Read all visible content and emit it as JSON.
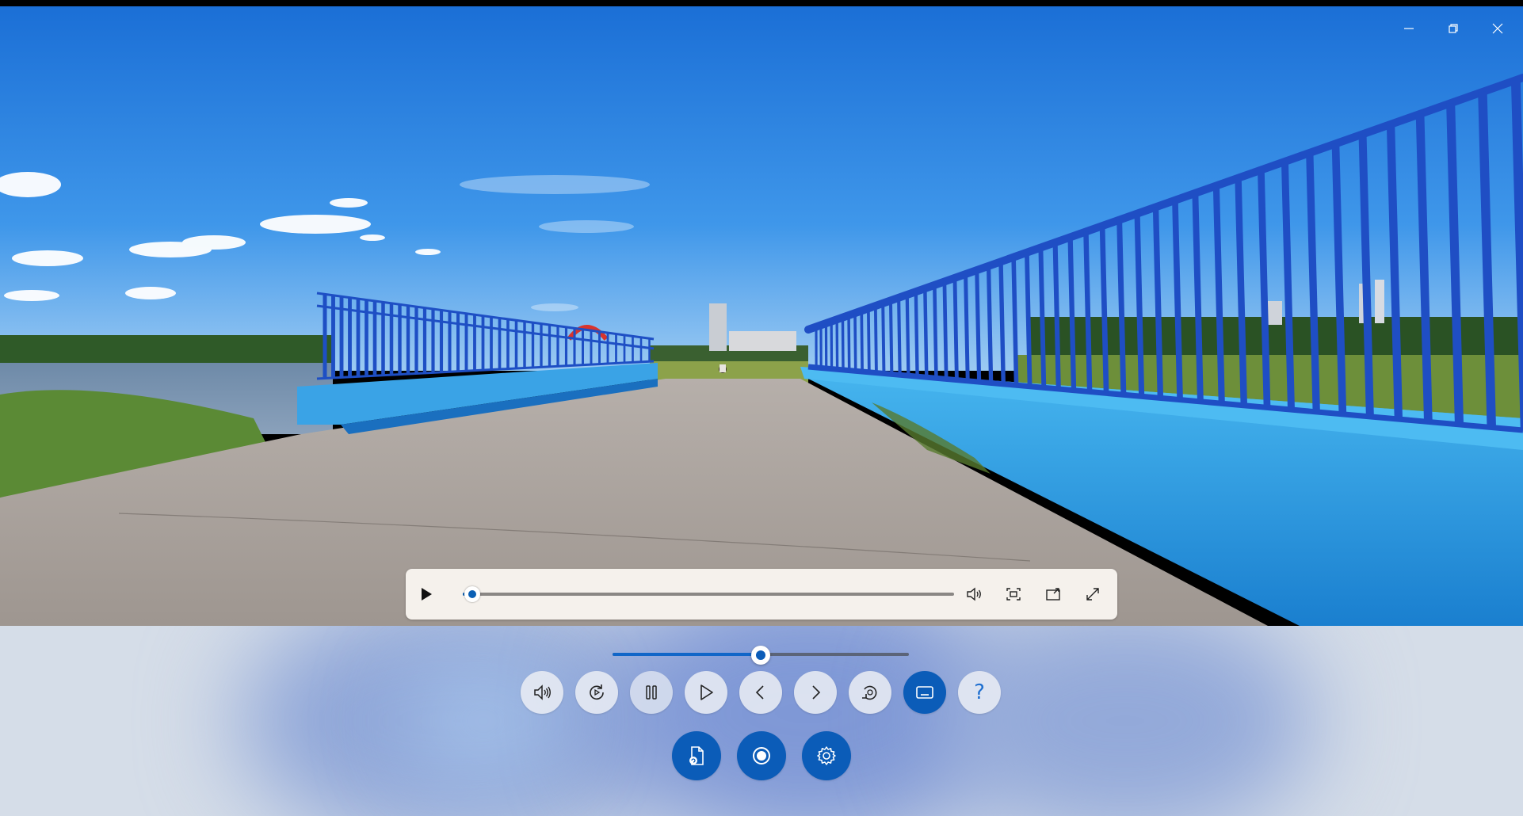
{
  "window": {
    "minimize_icon": "minimize-icon",
    "restore_icon": "restore-icon",
    "close_icon": "close-icon"
  },
  "video_bar": {
    "play_icon": "play-icon",
    "progress": 0.02,
    "volume_icon": "volume-icon",
    "aspect_icon": "aspect-ratio-icon",
    "cast_icon": "cast-icon",
    "fullscreen_icon": "fullscreen-icon"
  },
  "playback_rate": {
    "value": 0.5
  },
  "controls_row1": [
    {
      "name": "volume-button",
      "icon": "volume-icon"
    },
    {
      "name": "replay-button",
      "icon": "refresh-icon"
    },
    {
      "name": "pause-button",
      "icon": "pause-icon"
    },
    {
      "name": "play-button",
      "icon": "play-icon"
    },
    {
      "name": "previous-button",
      "icon": "chevron-left-icon"
    },
    {
      "name": "next-button",
      "icon": "chevron-right-icon"
    },
    {
      "name": "rotate-button",
      "icon": "rotate-icon"
    },
    {
      "name": "captions-button",
      "icon": "captions-icon",
      "active": true
    },
    {
      "name": "help-button",
      "icon": "help-icon",
      "label": "?"
    }
  ],
  "controls_row2": [
    {
      "name": "open-file-button",
      "icon": "file-icon"
    },
    {
      "name": "record-button",
      "icon": "record-icon"
    },
    {
      "name": "settings-button",
      "icon": "gear-icon"
    }
  ],
  "colors": {
    "accent": "#0b5cb8",
    "bar_bg": "#f5f1ec",
    "sky": "#2d86e0",
    "railing": "#1e4fc4"
  }
}
